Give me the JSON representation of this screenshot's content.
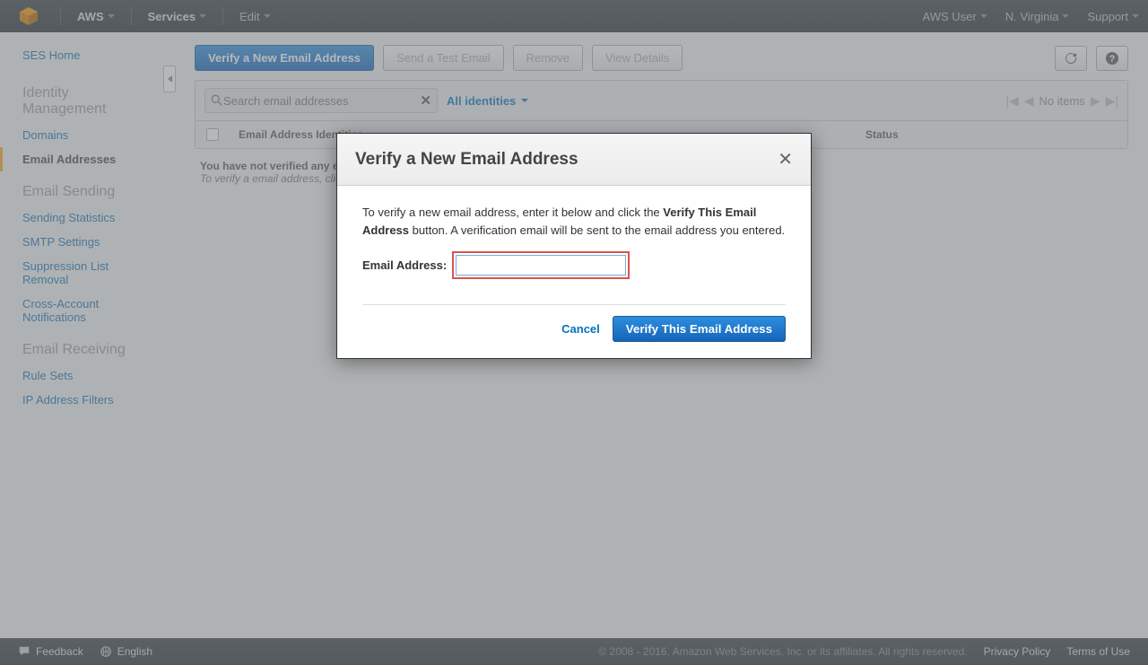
{
  "topnav": {
    "brand": "AWS",
    "services": "Services",
    "edit": "Edit",
    "user": "AWS User",
    "region": "N. Virginia",
    "support": "Support"
  },
  "sidebar": {
    "home": "SES Home",
    "sections": [
      {
        "title": "Identity Management",
        "links": [
          "Domains",
          "Email Addresses"
        ]
      },
      {
        "title": "Email Sending",
        "links": [
          "Sending Statistics",
          "SMTP Settings",
          "Suppression List Removal",
          "Cross-Account Notifications"
        ]
      },
      {
        "title": "Email Receiving",
        "links": [
          "Rule Sets",
          "IP Address Filters"
        ]
      }
    ],
    "active": "Email Addresses"
  },
  "toolbar": {
    "verify": "Verify a New Email Address",
    "send_test": "Send a Test Email",
    "remove": "Remove",
    "view_details": "View Details"
  },
  "search": {
    "placeholder": "Search email addresses"
  },
  "filter": {
    "label": "All identities"
  },
  "pager": {
    "label": "No items"
  },
  "table": {
    "col1": "Email Address Identities",
    "col2": "Status"
  },
  "empty": {
    "l1": "You have not verified any email addresses.",
    "l2": "To verify a email address, click the Verify a New Email Address button."
  },
  "modal": {
    "title": "Verify a New Email Address",
    "body_pre": "To verify a new email address, enter it below and click the ",
    "body_bold": "Verify This Email Address",
    "body_post": " button. A verification email will be sent to the email address you entered.",
    "label": "Email Address:",
    "cancel": "Cancel",
    "confirm": "Verify This Email Address"
  },
  "footer": {
    "feedback": "Feedback",
    "language": "English",
    "copy": "© 2008 - 2016, Amazon Web Services, Inc. or its affiliates. All rights reserved.",
    "privacy": "Privacy Policy",
    "terms": "Terms of Use"
  }
}
